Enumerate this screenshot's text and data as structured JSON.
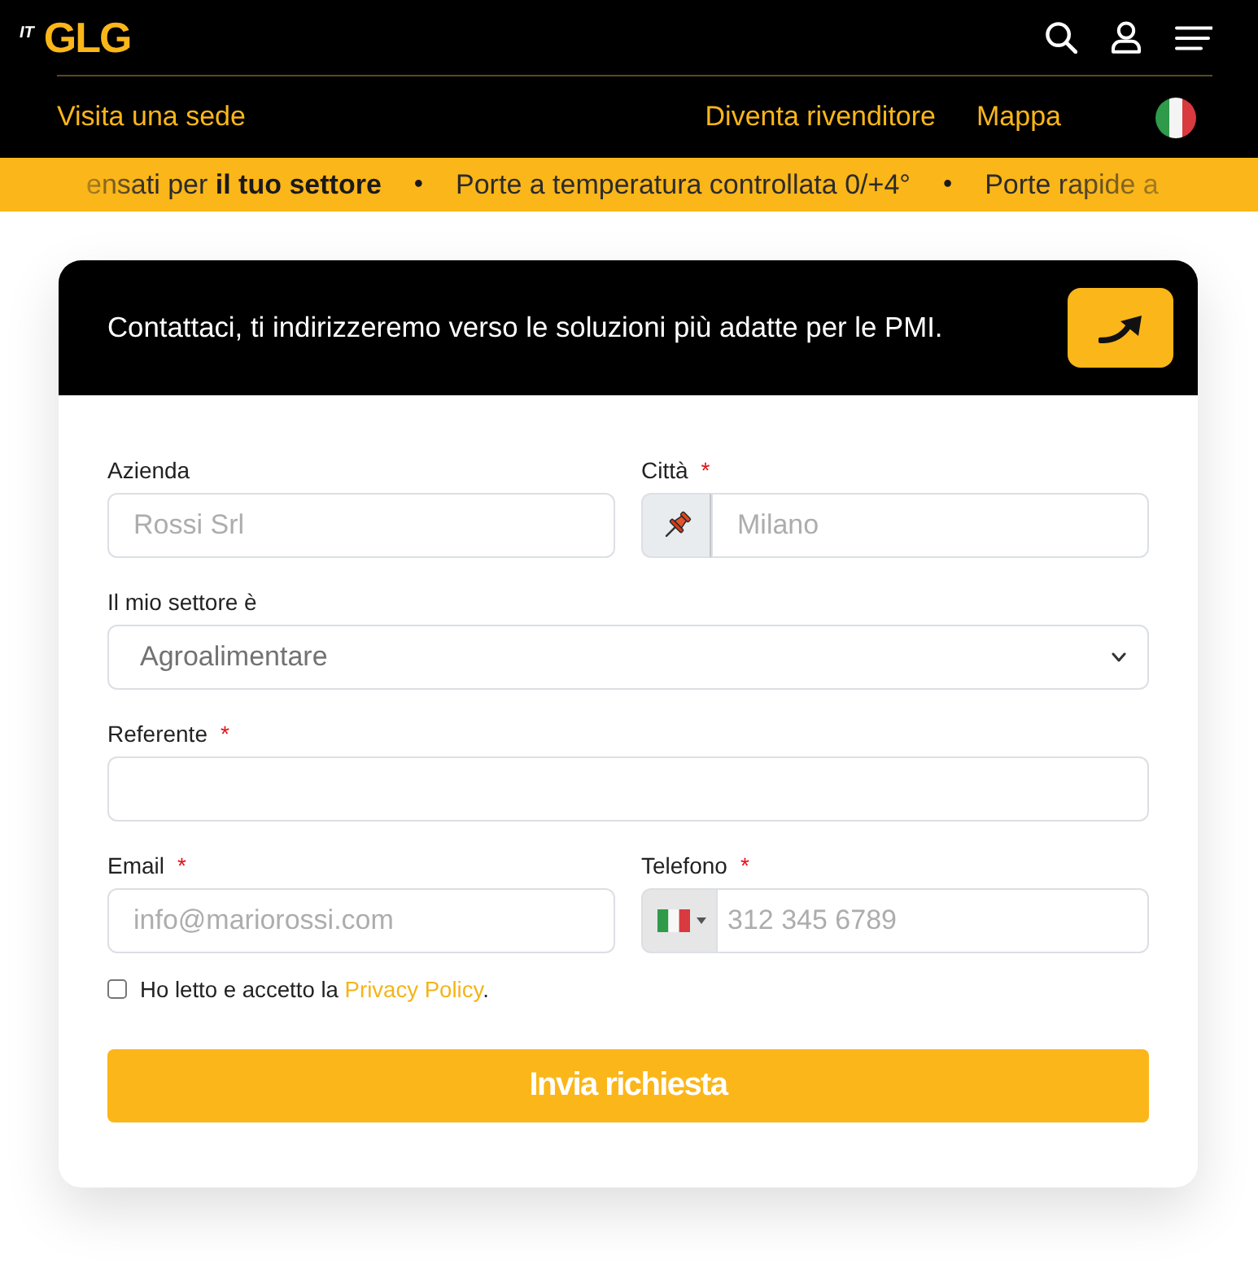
{
  "header": {
    "language_tag": "IT",
    "logo": "GLG",
    "links_left": [
      {
        "label": "Visita una sede"
      }
    ],
    "links_right": [
      {
        "label": "Diventa rivenditore"
      },
      {
        "label": "Mappa"
      }
    ]
  },
  "ticker": [
    {
      "kind": "text",
      "text": "ensati per **il tuo settore**"
    },
    {
      "kind": "bullet",
      "text": "•"
    },
    {
      "kind": "text",
      "text": "Porte a temperatura controllata 0/+4°"
    },
    {
      "kind": "bullet",
      "text": "•"
    },
    {
      "kind": "text",
      "text": "Porte rapide a"
    }
  ],
  "contact_card": {
    "title": "Contattaci, ti indirizzeremo verso le soluzioni più adatte per le PMI.",
    "rows": [
      [
        {
          "kind": "text",
          "label": "Azienda",
          "placeholder": "Rossi Srl"
        },
        {
          "kind": "pin",
          "label": "Città",
          "required_mark": "*",
          "placeholder": "Milano"
        }
      ],
      [
        {
          "kind": "select",
          "label": "Il mio settore è",
          "value": "Agroalimentare"
        }
      ],
      [
        {
          "kind": "text",
          "label": "Referente",
          "required_mark": "*"
        }
      ],
      [
        {
          "kind": "text",
          "label": "Email",
          "required_mark": "*",
          "placeholder": "info@mariorossi.com"
        },
        {
          "kind": "phone",
          "label": "Telefono",
          "required_mark": "*",
          "placeholder": "312 345 6789"
        }
      ]
    ],
    "consent": {
      "checked": false,
      "text": "Ho letto e accetto la",
      "link": "Privacy Policy",
      "after": "."
    },
    "submit": "Invia richiesta"
  }
}
